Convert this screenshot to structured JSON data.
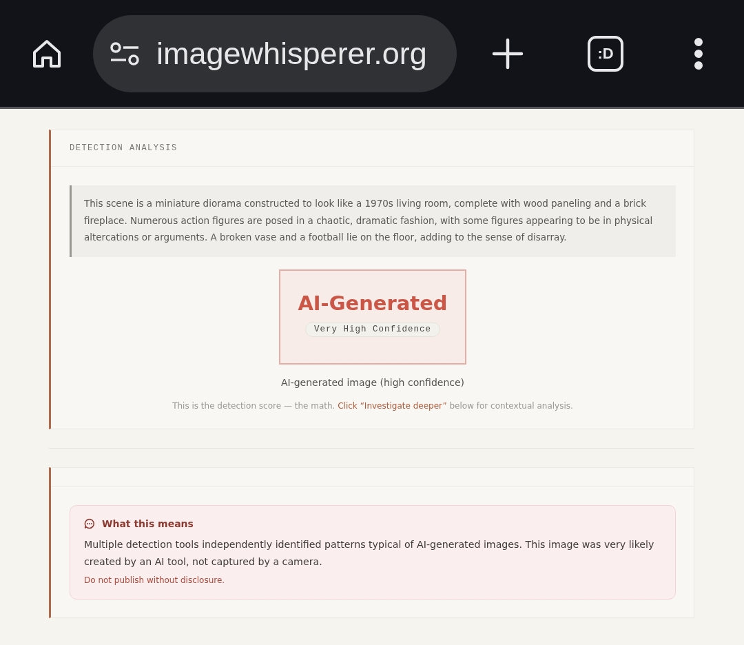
{
  "browser_bar": {
    "url": "imagewhisperer.org",
    "tab_switcher": ":D"
  },
  "analysis_card": {
    "title": "DETECTION ANALYSIS",
    "description": "This scene is a miniature diorama constructed to look like a 1970s living room, complete with wood paneling and a brick fireplace. Numerous action figures are posed in a chaotic, dramatic fashion, with some figures appearing to be in physical altercations or arguments. A broken vase and a football lie on the floor, adding to the sense of disarray.",
    "verdict": "AI-Generated",
    "confidence": "Very High Confidence",
    "caption": "AI-generated image (high confidence)",
    "note": "This is the detection score — the math.",
    "note_link": "Click “Investigate deeper”",
    "note_end": "below for contextual analysis."
  },
  "meaning_card": {
    "title": "What this means",
    "body": "Multiple detection tools independently identified patterns typical of AI-generated images. This image was very likely created by an AI tool, not captured by a camera.",
    "warning": "Do not publish without disclosure."
  }
}
